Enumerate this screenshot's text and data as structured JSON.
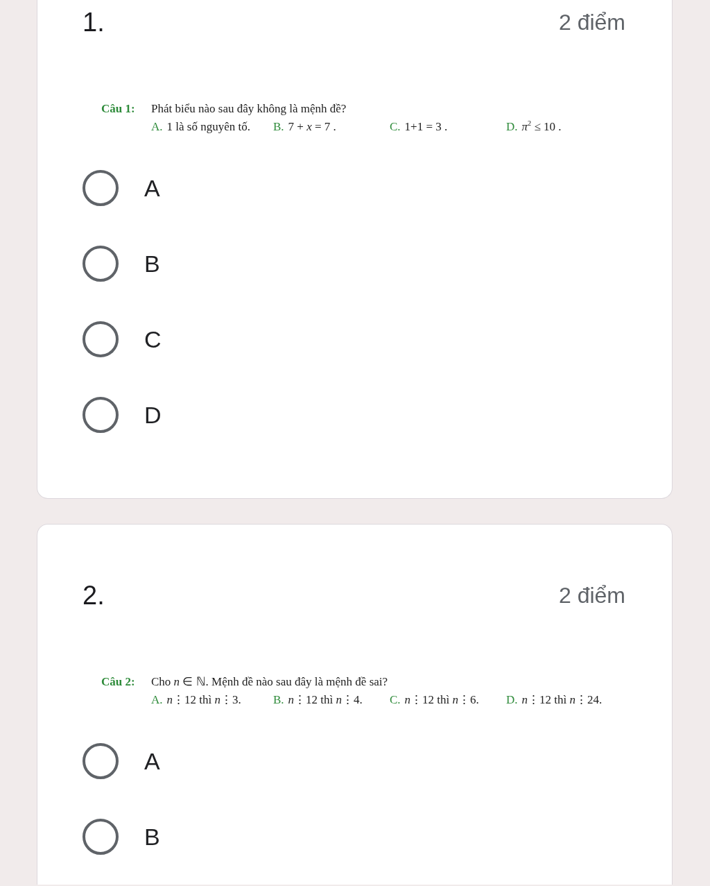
{
  "questions": [
    {
      "number": "1.",
      "points": "2 điểm",
      "prompt": {
        "label": "Câu 1:",
        "stem": "Phát biểu nào sau đây không là mệnh đề?",
        "options": [
          {
            "letter": "A.",
            "text": "1 là số nguyên tố."
          },
          {
            "letter": "B.",
            "text": "7 + *x* = 7 ."
          },
          {
            "letter": "C.",
            "text": "1+1 = 3 ."
          },
          {
            "letter": "D.",
            "text": "*π*$^{2}$ ≤ 10 ."
          }
        ]
      },
      "choices": [
        {
          "label": "A",
          "selected": false
        },
        {
          "label": "B",
          "selected": false
        },
        {
          "label": "C",
          "selected": false
        },
        {
          "label": "D",
          "selected": false
        }
      ]
    },
    {
      "number": "2.",
      "points": "2 điểm",
      "prompt": {
        "label": "Câu 2:",
        "stem": "Cho *n* ∈ ℕ. Mệnh đề nào sau đây là mệnh đề sai?",
        "options": [
          {
            "letter": "A.",
            "text": "*n*⋮12 thì *n*⋮3."
          },
          {
            "letter": "B.",
            "text": "*n*⋮12 thì *n*⋮4."
          },
          {
            "letter": "C.",
            "text": "*n*⋮12 thì *n*⋮6."
          },
          {
            "letter": "D.",
            "text": "*n*⋮12 thì *n*⋮24."
          }
        ]
      },
      "choices": [
        {
          "label": "A",
          "selected": false
        },
        {
          "label": "B",
          "selected": false
        }
      ]
    }
  ]
}
